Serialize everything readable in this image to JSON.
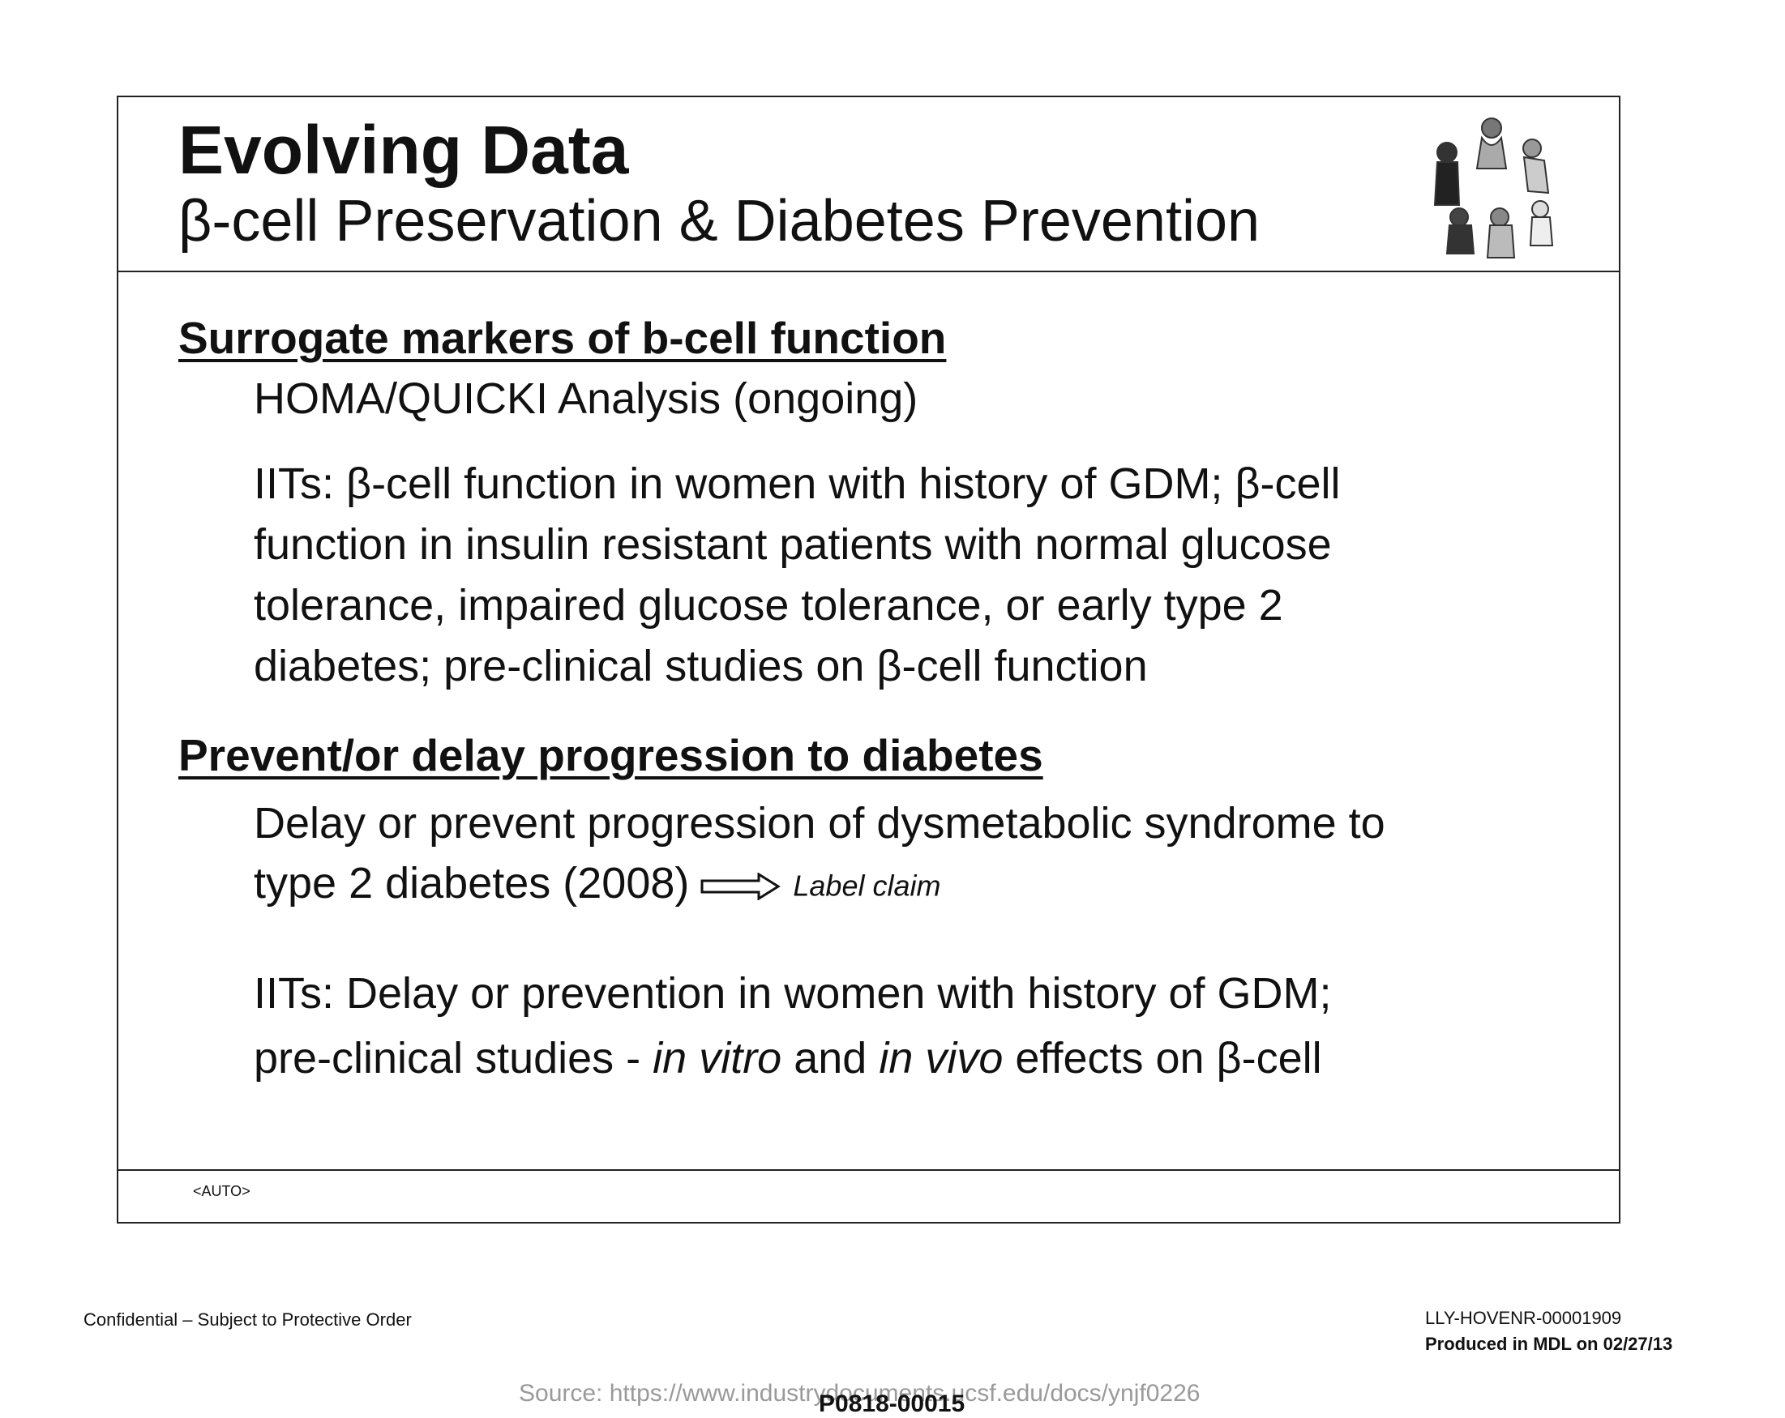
{
  "header": {
    "title": "Evolving Data",
    "subtitle": "β-cell Preservation & Diabetes Prevention"
  },
  "sections": [
    {
      "heading": "Surrogate markers of b-cell function",
      "line1": "HOMA/QUICKI Analysis (ongoing)",
      "para_lines": [
        "IITs: β-cell function in women with history of GDM; β-cell",
        "function in insulin resistant patients with normal glucose",
        "tolerance, impaired glucose tolerance,  or early type 2",
        "diabetes; pre-clinical studies on β-cell function"
      ]
    },
    {
      "heading": "Prevent/or delay progression to diabetes",
      "delay_line1": "Delay or prevent progression of dysmetabolic syndrome to",
      "delay_line2": "type 2 diabetes (2008)",
      "label_claim": "Label claim",
      "iits_line1": "IITs: Delay or prevention in women with history of GDM;",
      "iits_line2_pre": "pre-clinical studies - ",
      "iits_line2_italic1": "in vitro",
      "iits_line2_mid": " and ",
      "iits_line2_italic2": "in vivo",
      "iits_line2_post": " effects on β-cell"
    }
  ],
  "slide_footer": "<AUTO>",
  "page_footer": {
    "confidential": "Confidential – Subject to Protective Order",
    "doc_id": "LLY-HOVENR-00001909",
    "produced": "Produced in MDL on 02/27/13",
    "bates": "P0818-00015",
    "source": "Source: https://www.industrydocuments.ucsf.edu/docs/ynjf0226"
  }
}
